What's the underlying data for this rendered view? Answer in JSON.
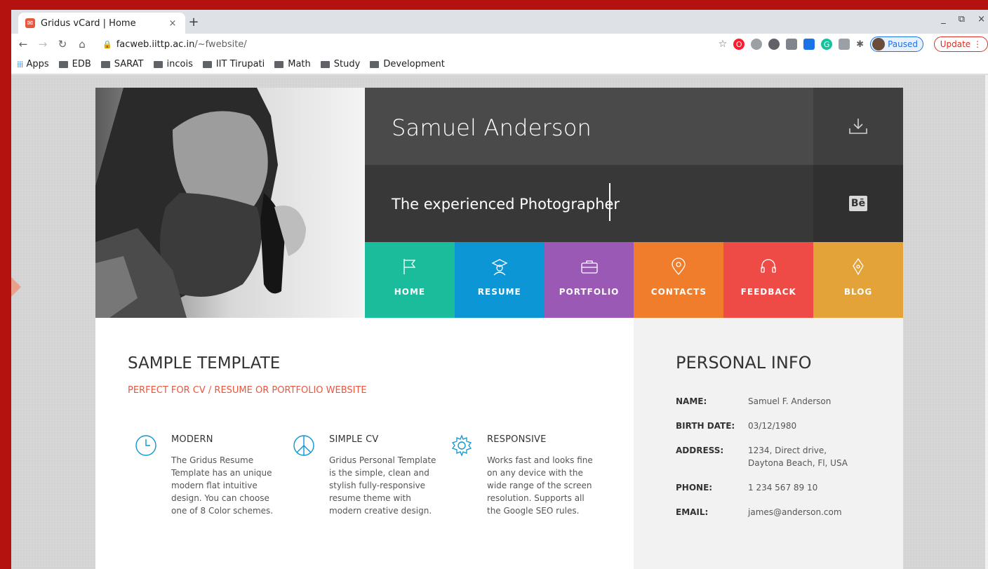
{
  "browser": {
    "tab_title": "Gridus vCard | Home",
    "tab_close": "×",
    "new_tab": "+",
    "url_host": "facweb.iittp.ac.in",
    "url_path": "/~fwebsite/",
    "profile_label": "Paused",
    "update_label": "Update",
    "window_controls": [
      "_",
      "⧉",
      "×"
    ]
  },
  "bookmarks": [
    {
      "label": "Apps",
      "icon": "apps-grid-icon"
    },
    {
      "label": "EDB",
      "icon": "folder-icon"
    },
    {
      "label": "SARAT",
      "icon": "folder-icon"
    },
    {
      "label": "incois",
      "icon": "folder-icon"
    },
    {
      "label": "IIT Tirupati",
      "icon": "folder-icon"
    },
    {
      "label": "Math",
      "icon": "folder-icon"
    },
    {
      "label": "Study",
      "icon": "folder-icon"
    },
    {
      "label": "Development",
      "icon": "folder-icon"
    }
  ],
  "profile": {
    "name": "Samuel Anderson",
    "subtitle": "The experienced Photographer",
    "behance_label": "Bē"
  },
  "nav": [
    {
      "label": "HOME",
      "icon": "flag-icon",
      "color": "#1abc9c"
    },
    {
      "label": "RESUME",
      "icon": "graduate-icon",
      "color": "#0d96d6"
    },
    {
      "label": "PORTFOLIO",
      "icon": "briefcase-icon",
      "color": "#9b59b6"
    },
    {
      "label": "CONTACTS",
      "icon": "location-pin-icon",
      "color": "#f07d2c"
    },
    {
      "label": "FEEDBACK",
      "icon": "headset-icon",
      "color": "#ef4b46"
    },
    {
      "label": "BLOG",
      "icon": "pen-nib-icon",
      "color": "#e3a338"
    }
  ],
  "content": {
    "heading": "SAMPLE TEMPLATE",
    "tagline": "PERFECT FOR CV / RESUME OR PORTFOLIO WEBSITE",
    "features": [
      {
        "title": "MODERN",
        "icon": "clock-icon",
        "desc": "The Gridus Resume Template has an unique modern flat intuitive design. You can choose one of 8 Color schemes."
      },
      {
        "title": "SIMPLE CV",
        "icon": "peace-icon",
        "desc": "Gridus Personal Template is the simple, clean and stylish fully-responsive resume theme with modern creative design."
      },
      {
        "title": "RESPONSIVE",
        "icon": "gear-icon",
        "desc": "Works fast and looks fine on any device with the wide range of the screen resolution. Supports all the Google SEO rules."
      }
    ]
  },
  "personal_info": {
    "heading": "PERSONAL INFO",
    "rows": [
      {
        "key": "NAME:",
        "value": "Samuel F. Anderson"
      },
      {
        "key": "BIRTH DATE:",
        "value": "03/12/1980"
      },
      {
        "key": "ADDRESS:",
        "value": "1234, Direct drive, Daytona Beach, Fl, USA"
      },
      {
        "key": "PHONE:",
        "value": "1 234 567 89 10"
      },
      {
        "key": "EMAIL:",
        "value": "james@anderson.com"
      }
    ]
  },
  "colors": {
    "accent": "#e9573f",
    "name_bg": "#4a4a4a",
    "subtitle_bg": "#383838",
    "info_bg": "#f2f2f2",
    "feature_icon": "#0d96d6"
  }
}
